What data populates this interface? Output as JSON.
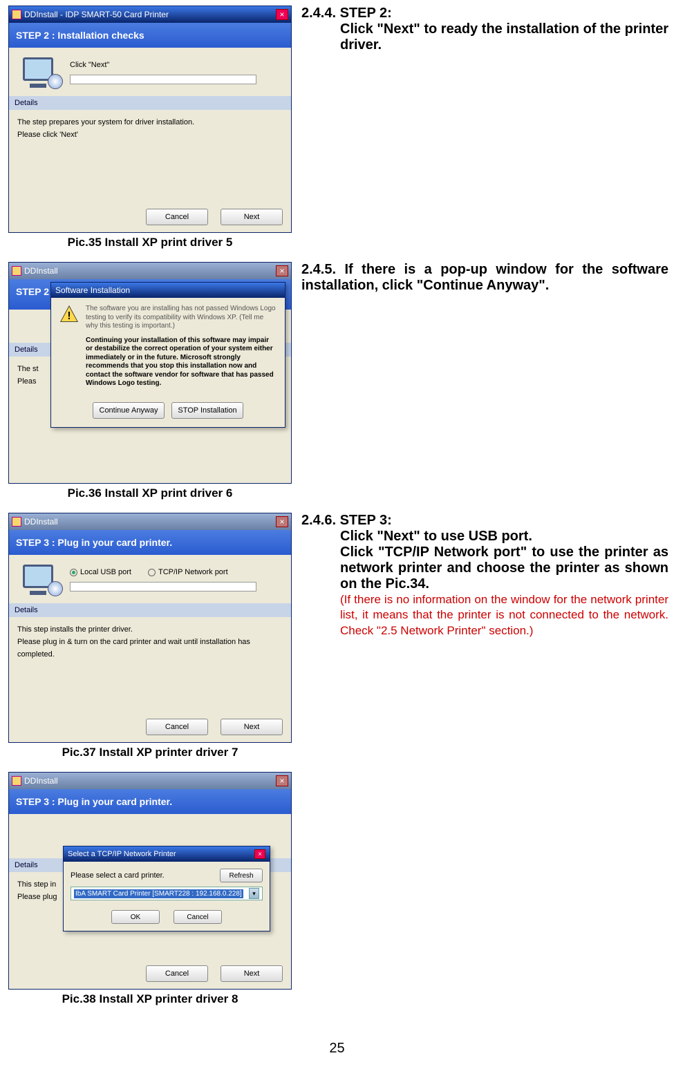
{
  "pic35": {
    "window_title": "DDInstall  -  IDP SMART-50 Card Printer",
    "step_banner": "STEP 2 :   Installation checks",
    "hint": "Click \"Next\"",
    "details_label": "Details",
    "details_line1": "The step prepares your system for driver installation.",
    "details_line2": "Please click 'Next'",
    "btn_cancel": "Cancel",
    "btn_next": "Next",
    "caption": "Pic.35    Install XP print driver 5"
  },
  "instr244": {
    "title": "2.4.4. STEP 2:",
    "body": "Click \"Next\" to ready the installation of the printer driver."
  },
  "pic36": {
    "window_title": "DDInstall",
    "step_banner": "STEP 2 :",
    "popup_title": "Software Installation",
    "para1": "The software you are installing has not passed Windows Logo testing to verify its compatibility with Windows XP. (Tell me why this testing is important.)",
    "para2_bold": "Continuing your installation of this software may impair or destabilize the correct operation of your system either immediately or in the future. Microsoft strongly recommends that you stop this installation now and contact the software vendor for software that has passed Windows Logo testing.",
    "btn_continue": "Continue Anyway",
    "btn_stop": "STOP Installation",
    "details_label": "Details",
    "left_line1": "The st",
    "left_line2": "Pleas",
    "caption": "Pic.36    Install XP print driver 6"
  },
  "instr245": {
    "title": "2.4.5. If there is a pop-up window for the software installation, click \"Continue Anyway\"."
  },
  "pic37": {
    "window_title": "DDInstall",
    "step_banner": "STEP 3 :  Plug in your card printer.",
    "radio_local": "Local USB port",
    "radio_tcp": "TCP/IP Network port",
    "details_label": "Details",
    "details_line1": "This step installs the printer driver.",
    "details_line2": "Please plug in & turn on the card printer and wait until installation has completed.",
    "btn_cancel": "Cancel",
    "btn_next": "Next",
    "caption": "Pic.37    Install XP printer driver 7"
  },
  "instr246": {
    "title": "2.4.6. STEP 3:",
    "body1": "Click \"Next\" to use USB port.",
    "body2": "Click \"TCP/IP Network port\" to use the printer as network printer and choose the printer as shown on the Pic.34.",
    "red": "(If there is no information on the window for the network printer list, it means that the printer is not connected to the network. Check \"2.5 Network Printer\" section.)"
  },
  "pic38": {
    "window_title": "DDInstall",
    "step_banner": "STEP 3 :  Plug in your card printer.",
    "popup_title": "Select a TCP/IP Network Printer",
    "popup_line": "Please select a card printer.",
    "btn_refresh": "Refresh",
    "select_text": "IbA SMART Card Printer  [SMART228 : 192.168.0.228]",
    "btn_ok": "OK",
    "btn_cancel_p": "Cancel",
    "details_label": "Details",
    "left_line1": "This step in",
    "left_line2": "Please plug",
    "btn_cancel": "Cancel",
    "btn_next": "Next",
    "caption": "Pic.38    Install XP printer driver 8"
  },
  "page_number": "25"
}
